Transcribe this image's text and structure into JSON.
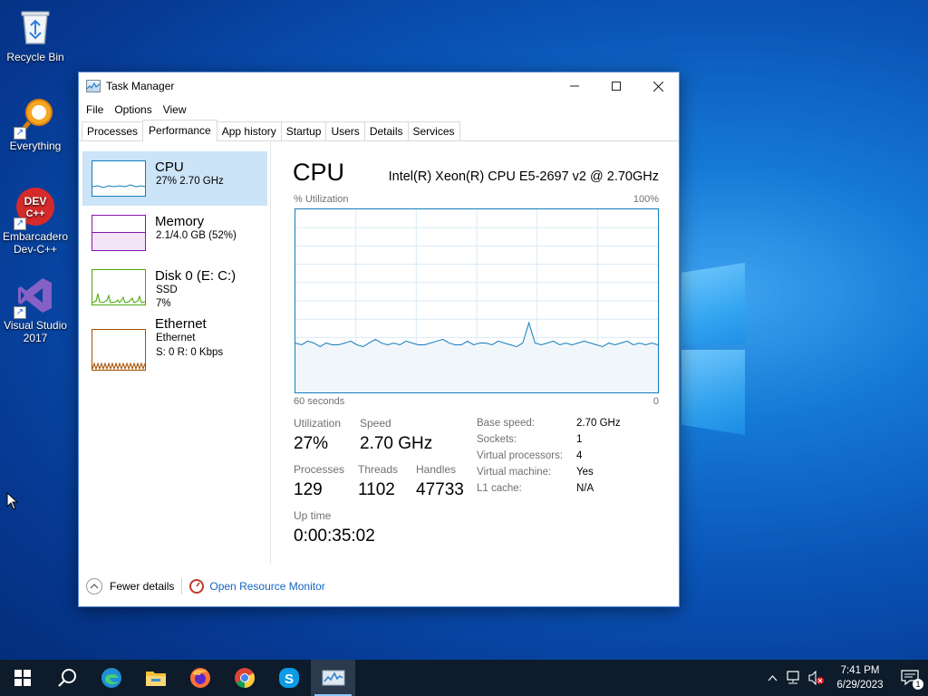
{
  "desktop": {
    "icons": [
      {
        "label": "Recycle Bin",
        "icon": "recycle-bin-icon"
      },
      {
        "label": "Everything",
        "icon": "everything-search-icon"
      },
      {
        "label": "Embarcadero Dev-C++",
        "icon": "devcpp-icon",
        "badge": "DEV C++"
      },
      {
        "label": "Visual Studio 2017",
        "icon": "visual-studio-icon"
      }
    ]
  },
  "window": {
    "title": "Task Manager",
    "controls": {
      "minimize": "—",
      "maximize": "☐",
      "close": "✕"
    }
  },
  "menu": [
    "File",
    "Options",
    "View"
  ],
  "tabs": [
    "Processes",
    "Performance",
    "App history",
    "Startup",
    "Users",
    "Details",
    "Services"
  ],
  "active_tab": "Performance",
  "resources": [
    {
      "name": "CPU",
      "line1": "27%  2.70 GHz",
      "line2": "",
      "color": "#117dbb"
    },
    {
      "name": "Memory",
      "line1": "2.1/4.0 GB (52%)",
      "line2": "",
      "color": "#8b12ae"
    },
    {
      "name": "Disk 0 (E: C:)",
      "line1": "SSD",
      "line2": "7%",
      "color": "#4da60c"
    },
    {
      "name": "Ethernet",
      "line1": "Ethernet",
      "line2": "S: 0  R: 0 Kbps",
      "color": "#a74f01"
    }
  ],
  "cpu": {
    "title": "CPU",
    "model": "Intel(R) Xeon(R) CPU E5-2697 v2 @ 2.70GHz",
    "graph_label": "% Utilization",
    "graph_max": "100%",
    "graph_time": "60 seconds",
    "graph_min": "0",
    "history": [
      27,
      26,
      28,
      27,
      25,
      27,
      26,
      26,
      27,
      28,
      26,
      25,
      27,
      29,
      27,
      26,
      27,
      26,
      28,
      27,
      26,
      26,
      27,
      28,
      29,
      27,
      26,
      26,
      28,
      26,
      27,
      27,
      26,
      28,
      27,
      26,
      25,
      27,
      38,
      27,
      26,
      27,
      28,
      26,
      27,
      26,
      27,
      28,
      27,
      26,
      25,
      27,
      26,
      27,
      28,
      26,
      27,
      26,
      27,
      26
    ],
    "stats": {
      "utilization": {
        "label": "Utilization",
        "value": "27%"
      },
      "speed": {
        "label": "Speed",
        "value": "2.70 GHz"
      },
      "processes": {
        "label": "Processes",
        "value": "129"
      },
      "threads": {
        "label": "Threads",
        "value": "1102"
      },
      "handles": {
        "label": "Handles",
        "value": "47733"
      },
      "uptime": {
        "label": "Up time",
        "value": "0:00:35:02"
      }
    },
    "details": [
      {
        "label": "Base speed:",
        "value": "2.70 GHz"
      },
      {
        "label": "Sockets:",
        "value": "1"
      },
      {
        "label": "Virtual processors:",
        "value": "4"
      },
      {
        "label": "Virtual machine:",
        "value": "Yes"
      },
      {
        "label": "L1 cache:",
        "value": "N/A"
      }
    ]
  },
  "footer": {
    "fewer_details": "Fewer details",
    "resource_monitor": "Open Resource Monitor"
  },
  "taskbar": {
    "apps": [
      "start-icon",
      "search-icon",
      "edge-icon",
      "file-explorer-icon",
      "firefox-icon",
      "chrome-icon",
      "skype-icon",
      "task-manager-icon"
    ],
    "time": "7:41 PM",
    "date": "6/29/2023",
    "notification_count": "1"
  }
}
